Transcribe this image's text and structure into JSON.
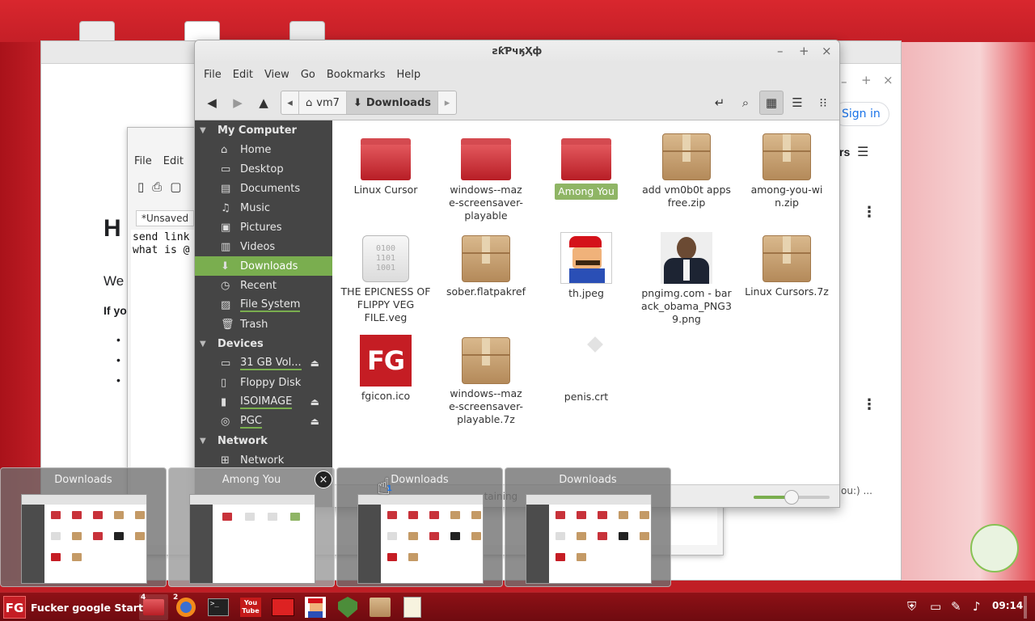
{
  "file_manager": {
    "title": "ƨƙƤчӄҲф",
    "menu": [
      "File",
      "Edit",
      "View",
      "Go",
      "Bookmarks",
      "Help"
    ],
    "breadcrumbs": [
      "vm7",
      "Downloads"
    ],
    "sidebar": {
      "sections": [
        {
          "label": "My Computer",
          "items": [
            {
              "label": "Home",
              "icon": "home-icon"
            },
            {
              "label": "Desktop",
              "icon": "desktop-icon"
            },
            {
              "label": "Documents",
              "icon": "documents-icon"
            },
            {
              "label": "Music",
              "icon": "music-icon"
            },
            {
              "label": "Pictures",
              "icon": "pictures-icon"
            },
            {
              "label": "Videos",
              "icon": "videos-icon"
            },
            {
              "label": "Downloads",
              "icon": "downloads-icon",
              "active": true
            },
            {
              "label": "Recent",
              "icon": "recent-icon"
            },
            {
              "label": "File System",
              "icon": "filesystem-icon"
            },
            {
              "label": "Trash",
              "icon": "trash-icon"
            }
          ]
        },
        {
          "label": "Devices",
          "items": [
            {
              "label": "31 GB Vol...",
              "icon": "drive-icon",
              "eject": true
            },
            {
              "label": "Floppy Disk",
              "icon": "floppy-icon"
            },
            {
              "label": "ISOIMAGE",
              "icon": "usb-icon",
              "eject": true
            },
            {
              "label": "PGC",
              "icon": "disc-icon",
              "eject": true
            }
          ]
        },
        {
          "label": "Network",
          "items": [
            {
              "label": "Network",
              "icon": "network-icon"
            }
          ]
        }
      ]
    },
    "files": [
      {
        "name": "Linux Cursor",
        "type": "folder"
      },
      {
        "name": "windows--maze-screensaver-playable",
        "type": "folder"
      },
      {
        "name": "Among You",
        "type": "folder",
        "selected": true
      },
      {
        "name": "add vm0b0t apps free.zip",
        "type": "archive"
      },
      {
        "name": "among-you-win.zip",
        "type": "archive"
      },
      {
        "name": "THE EPICNESS OF FLIPPY VEG FILE.veg",
        "type": "binary"
      },
      {
        "name": "sober.flatpakref",
        "type": "archive"
      },
      {
        "name": "th.jpeg",
        "type": "image-mario"
      },
      {
        "name": "pngimg.com - barack_obama_PNG39.png",
        "type": "image-portrait"
      },
      {
        "name": "Linux Cursors.7z",
        "type": "archive"
      },
      {
        "name": "fgicon.ico",
        "type": "image-fg"
      },
      {
        "name": "windows--maze-screensaver-playable.7z",
        "type": "archive"
      },
      {
        "name": "penis.crt",
        "type": "certificate"
      }
    ],
    "binary_text": "0100\n1101\n1001",
    "fg_icon_text": "FG",
    "zoom": 0.5
  },
  "background": {
    "editor_menu": [
      "File",
      "Edit",
      "V"
    ],
    "editor_tab": "*Unsaved",
    "editor_text": "send link\nwhat is @",
    "page_heading": "H",
    "page_para": "We",
    "page_bold": "If yo",
    "sign_in": "Sign in",
    "right_text": "rs",
    "status_partial": "ntaining",
    "status_partial2": "ou:) ..."
  },
  "switcher": {
    "items": [
      {
        "label": "Downloads"
      },
      {
        "label": "Among You"
      },
      {
        "label": "Downloads"
      },
      {
        "label": "Downloads"
      }
    ],
    "close": "×",
    "cursor_badge": "1"
  },
  "taskbar": {
    "start_logo": "FG",
    "start_label": "Fucker google Start",
    "apps": [
      {
        "name": "files",
        "badge": "4"
      },
      {
        "name": "firefox",
        "badge": "2"
      },
      {
        "name": "terminal",
        "badge": ""
      },
      {
        "name": "youtube",
        "badge": "",
        "label": "You\nTube"
      },
      {
        "name": "youtube-exe",
        "badge": ""
      },
      {
        "name": "mario",
        "badge": ""
      },
      {
        "name": "update-manager",
        "badge": ""
      },
      {
        "name": "archive-manager",
        "badge": ""
      },
      {
        "name": "text-editor",
        "badge": ""
      }
    ],
    "clock": "09:14"
  },
  "colors": {
    "accent_green": "#7aae4f",
    "brand_red": "#c51d24"
  }
}
